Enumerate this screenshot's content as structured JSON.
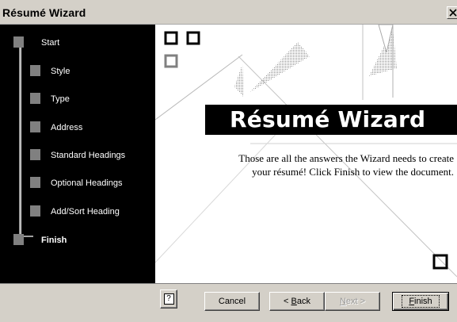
{
  "window": {
    "title": "Résumé Wizard",
    "close_icon": "close-icon"
  },
  "sidebar": {
    "steps": [
      {
        "label": "Start",
        "state": "done"
      },
      {
        "label": "Style",
        "state": "done"
      },
      {
        "label": "Type",
        "state": "done"
      },
      {
        "label": "Address",
        "state": "done"
      },
      {
        "label": "Standard Headings",
        "state": "done"
      },
      {
        "label": "Optional Headings",
        "state": "done"
      },
      {
        "label": "Add/Sort Heading",
        "state": "done"
      },
      {
        "label": "Finish",
        "state": "current"
      }
    ]
  },
  "content": {
    "banner_title": "Résumé Wizard",
    "message": "Those are all the answers the Wizard needs to create your résumé!  Click Finish to view the document."
  },
  "buttons": {
    "help_label": "?",
    "cancel": "Cancel",
    "back_prefix": "< ",
    "back_mnemonic": "B",
    "back_rest": "ack",
    "next_mnemonic": "N",
    "next_rest": "ext >",
    "finish_mnemonic": "F",
    "finish_rest": "inish"
  },
  "colors": {
    "dialog_face": "#d4d0c8",
    "sidebar_bg": "#000000",
    "step_marker": "#808080",
    "content_bg": "#ffffff"
  }
}
